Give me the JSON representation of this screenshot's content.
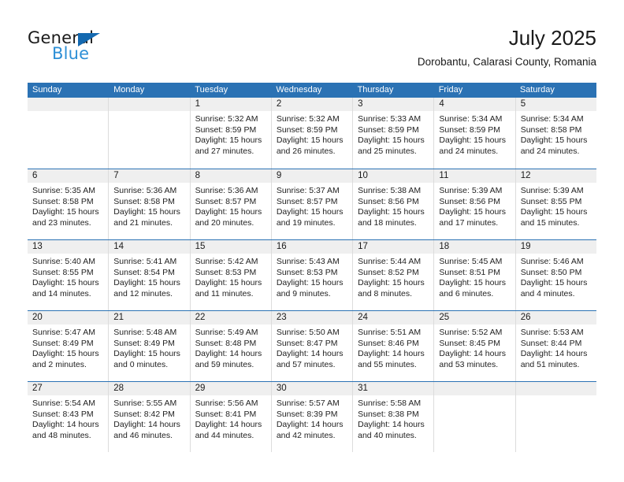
{
  "brand": {
    "name_top": "General",
    "name_bottom": "Blue",
    "triangle_color": "#1469b0",
    "blue_text_color": "#2d8fd6"
  },
  "header": {
    "title": "July 2025",
    "subtitle": "Dorobantu, Calarasi County, Romania"
  },
  "theme": {
    "header_blue": "#2b72b4",
    "day_number_band": "#efefef",
    "cell_border": "#dcdcdc"
  },
  "weekdays": [
    "Sunday",
    "Monday",
    "Tuesday",
    "Wednesday",
    "Thursday",
    "Friday",
    "Saturday"
  ],
  "weeks": [
    [
      {
        "day": "",
        "sunrise": "",
        "sunset": "",
        "daylight_line1": "",
        "daylight_line2": "",
        "empty": true
      },
      {
        "day": "",
        "sunrise": "",
        "sunset": "",
        "daylight_line1": "",
        "daylight_line2": "",
        "empty": true
      },
      {
        "day": "1",
        "sunrise": "Sunrise: 5:32 AM",
        "sunset": "Sunset: 8:59 PM",
        "daylight_line1": "Daylight: 15 hours",
        "daylight_line2": "and 27 minutes."
      },
      {
        "day": "2",
        "sunrise": "Sunrise: 5:32 AM",
        "sunset": "Sunset: 8:59 PM",
        "daylight_line1": "Daylight: 15 hours",
        "daylight_line2": "and 26 minutes."
      },
      {
        "day": "3",
        "sunrise": "Sunrise: 5:33 AM",
        "sunset": "Sunset: 8:59 PM",
        "daylight_line1": "Daylight: 15 hours",
        "daylight_line2": "and 25 minutes."
      },
      {
        "day": "4",
        "sunrise": "Sunrise: 5:34 AM",
        "sunset": "Sunset: 8:59 PM",
        "daylight_line1": "Daylight: 15 hours",
        "daylight_line2": "and 24 minutes."
      },
      {
        "day": "5",
        "sunrise": "Sunrise: 5:34 AM",
        "sunset": "Sunset: 8:58 PM",
        "daylight_line1": "Daylight: 15 hours",
        "daylight_line2": "and 24 minutes."
      }
    ],
    [
      {
        "day": "6",
        "sunrise": "Sunrise: 5:35 AM",
        "sunset": "Sunset: 8:58 PM",
        "daylight_line1": "Daylight: 15 hours",
        "daylight_line2": "and 23 minutes."
      },
      {
        "day": "7",
        "sunrise": "Sunrise: 5:36 AM",
        "sunset": "Sunset: 8:58 PM",
        "daylight_line1": "Daylight: 15 hours",
        "daylight_line2": "and 21 minutes."
      },
      {
        "day": "8",
        "sunrise": "Sunrise: 5:36 AM",
        "sunset": "Sunset: 8:57 PM",
        "daylight_line1": "Daylight: 15 hours",
        "daylight_line2": "and 20 minutes."
      },
      {
        "day": "9",
        "sunrise": "Sunrise: 5:37 AM",
        "sunset": "Sunset: 8:57 PM",
        "daylight_line1": "Daylight: 15 hours",
        "daylight_line2": "and 19 minutes."
      },
      {
        "day": "10",
        "sunrise": "Sunrise: 5:38 AM",
        "sunset": "Sunset: 8:56 PM",
        "daylight_line1": "Daylight: 15 hours",
        "daylight_line2": "and 18 minutes."
      },
      {
        "day": "11",
        "sunrise": "Sunrise: 5:39 AM",
        "sunset": "Sunset: 8:56 PM",
        "daylight_line1": "Daylight: 15 hours",
        "daylight_line2": "and 17 minutes."
      },
      {
        "day": "12",
        "sunrise": "Sunrise: 5:39 AM",
        "sunset": "Sunset: 8:55 PM",
        "daylight_line1": "Daylight: 15 hours",
        "daylight_line2": "and 15 minutes."
      }
    ],
    [
      {
        "day": "13",
        "sunrise": "Sunrise: 5:40 AM",
        "sunset": "Sunset: 8:55 PM",
        "daylight_line1": "Daylight: 15 hours",
        "daylight_line2": "and 14 minutes."
      },
      {
        "day": "14",
        "sunrise": "Sunrise: 5:41 AM",
        "sunset": "Sunset: 8:54 PM",
        "daylight_line1": "Daylight: 15 hours",
        "daylight_line2": "and 12 minutes."
      },
      {
        "day": "15",
        "sunrise": "Sunrise: 5:42 AM",
        "sunset": "Sunset: 8:53 PM",
        "daylight_line1": "Daylight: 15 hours",
        "daylight_line2": "and 11 minutes."
      },
      {
        "day": "16",
        "sunrise": "Sunrise: 5:43 AM",
        "sunset": "Sunset: 8:53 PM",
        "daylight_line1": "Daylight: 15 hours",
        "daylight_line2": "and 9 minutes."
      },
      {
        "day": "17",
        "sunrise": "Sunrise: 5:44 AM",
        "sunset": "Sunset: 8:52 PM",
        "daylight_line1": "Daylight: 15 hours",
        "daylight_line2": "and 8 minutes."
      },
      {
        "day": "18",
        "sunrise": "Sunrise: 5:45 AM",
        "sunset": "Sunset: 8:51 PM",
        "daylight_line1": "Daylight: 15 hours",
        "daylight_line2": "and 6 minutes."
      },
      {
        "day": "19",
        "sunrise": "Sunrise: 5:46 AM",
        "sunset": "Sunset: 8:50 PM",
        "daylight_line1": "Daylight: 15 hours",
        "daylight_line2": "and 4 minutes."
      }
    ],
    [
      {
        "day": "20",
        "sunrise": "Sunrise: 5:47 AM",
        "sunset": "Sunset: 8:49 PM",
        "daylight_line1": "Daylight: 15 hours",
        "daylight_line2": "and 2 minutes."
      },
      {
        "day": "21",
        "sunrise": "Sunrise: 5:48 AM",
        "sunset": "Sunset: 8:49 PM",
        "daylight_line1": "Daylight: 15 hours",
        "daylight_line2": "and 0 minutes."
      },
      {
        "day": "22",
        "sunrise": "Sunrise: 5:49 AM",
        "sunset": "Sunset: 8:48 PM",
        "daylight_line1": "Daylight: 14 hours",
        "daylight_line2": "and 59 minutes."
      },
      {
        "day": "23",
        "sunrise": "Sunrise: 5:50 AM",
        "sunset": "Sunset: 8:47 PM",
        "daylight_line1": "Daylight: 14 hours",
        "daylight_line2": "and 57 minutes."
      },
      {
        "day": "24",
        "sunrise": "Sunrise: 5:51 AM",
        "sunset": "Sunset: 8:46 PM",
        "daylight_line1": "Daylight: 14 hours",
        "daylight_line2": "and 55 minutes."
      },
      {
        "day": "25",
        "sunrise": "Sunrise: 5:52 AM",
        "sunset": "Sunset: 8:45 PM",
        "daylight_line1": "Daylight: 14 hours",
        "daylight_line2": "and 53 minutes."
      },
      {
        "day": "26",
        "sunrise": "Sunrise: 5:53 AM",
        "sunset": "Sunset: 8:44 PM",
        "daylight_line1": "Daylight: 14 hours",
        "daylight_line2": "and 51 minutes."
      }
    ],
    [
      {
        "day": "27",
        "sunrise": "Sunrise: 5:54 AM",
        "sunset": "Sunset: 8:43 PM",
        "daylight_line1": "Daylight: 14 hours",
        "daylight_line2": "and 48 minutes."
      },
      {
        "day": "28",
        "sunrise": "Sunrise: 5:55 AM",
        "sunset": "Sunset: 8:42 PM",
        "daylight_line1": "Daylight: 14 hours",
        "daylight_line2": "and 46 minutes."
      },
      {
        "day": "29",
        "sunrise": "Sunrise: 5:56 AM",
        "sunset": "Sunset: 8:41 PM",
        "daylight_line1": "Daylight: 14 hours",
        "daylight_line2": "and 44 minutes."
      },
      {
        "day": "30",
        "sunrise": "Sunrise: 5:57 AM",
        "sunset": "Sunset: 8:39 PM",
        "daylight_line1": "Daylight: 14 hours",
        "daylight_line2": "and 42 minutes."
      },
      {
        "day": "31",
        "sunrise": "Sunrise: 5:58 AM",
        "sunset": "Sunset: 8:38 PM",
        "daylight_line1": "Daylight: 14 hours",
        "daylight_line2": "and 40 minutes."
      },
      {
        "day": "",
        "sunrise": "",
        "sunset": "",
        "daylight_line1": "",
        "daylight_line2": "",
        "empty": true
      },
      {
        "day": "",
        "sunrise": "",
        "sunset": "",
        "daylight_line1": "",
        "daylight_line2": "",
        "empty": true
      }
    ]
  ]
}
